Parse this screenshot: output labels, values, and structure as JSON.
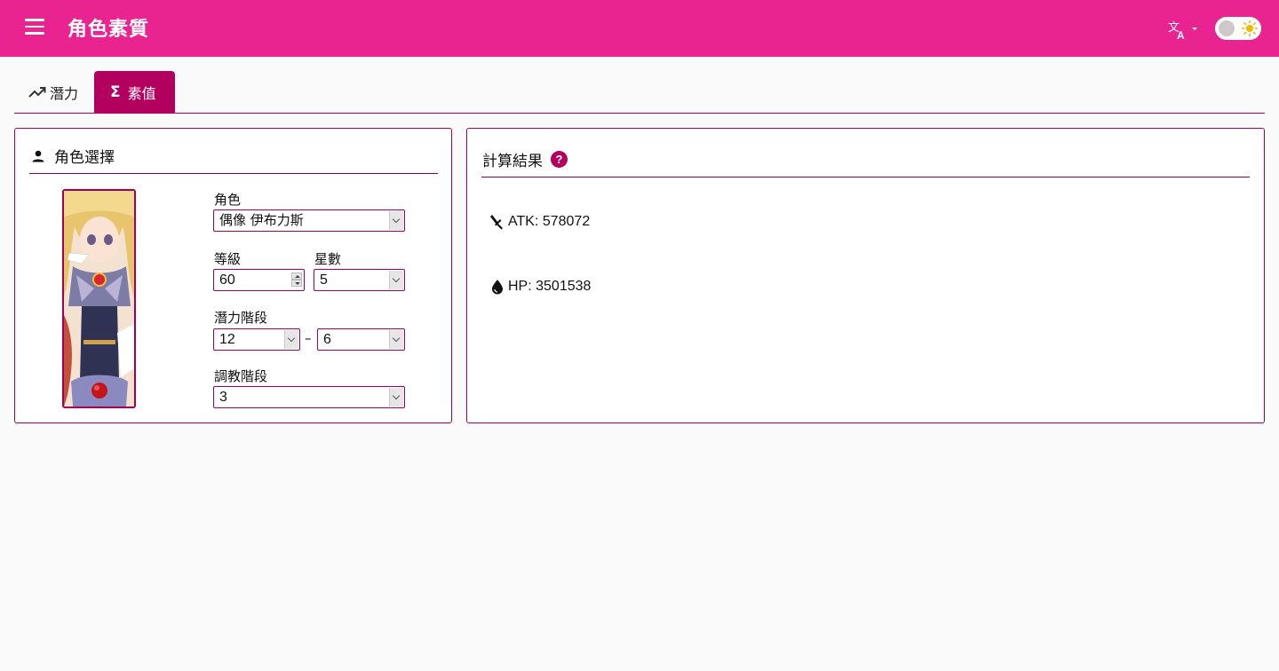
{
  "header": {
    "title": "角色素質",
    "menu_icon": "menu-icon",
    "translate_icon": "translate-icon",
    "theme_icon": "sun-icon"
  },
  "tabs": [
    {
      "label": "潛力",
      "icon": "trending-up-icon",
      "active": false
    },
    {
      "label": "素值",
      "icon": "sigma-icon",
      "active": true
    }
  ],
  "character_panel": {
    "title": "角色選擇",
    "icon": "person-icon",
    "character_label": "角色",
    "character_value": "偶像 伊布力斯",
    "level_label": "等級",
    "level_value": "60",
    "stars_label": "星數",
    "stars_value": "5",
    "potential_label": "潛力階段",
    "potential_from": "12",
    "potential_separator": "–",
    "potential_to": "6",
    "training_label": "調教階段",
    "training_value": "3"
  },
  "result_panel": {
    "title": "計算結果",
    "help_glyph": "?",
    "atk_text": "ATK: 578072",
    "atk_icon": "sword-icon",
    "hp_text": "HP: 3501538",
    "hp_icon": "droplet-icon"
  },
  "colors": {
    "appbar": "#e92491",
    "accent": "#b3005e",
    "border": "#a0005a"
  }
}
